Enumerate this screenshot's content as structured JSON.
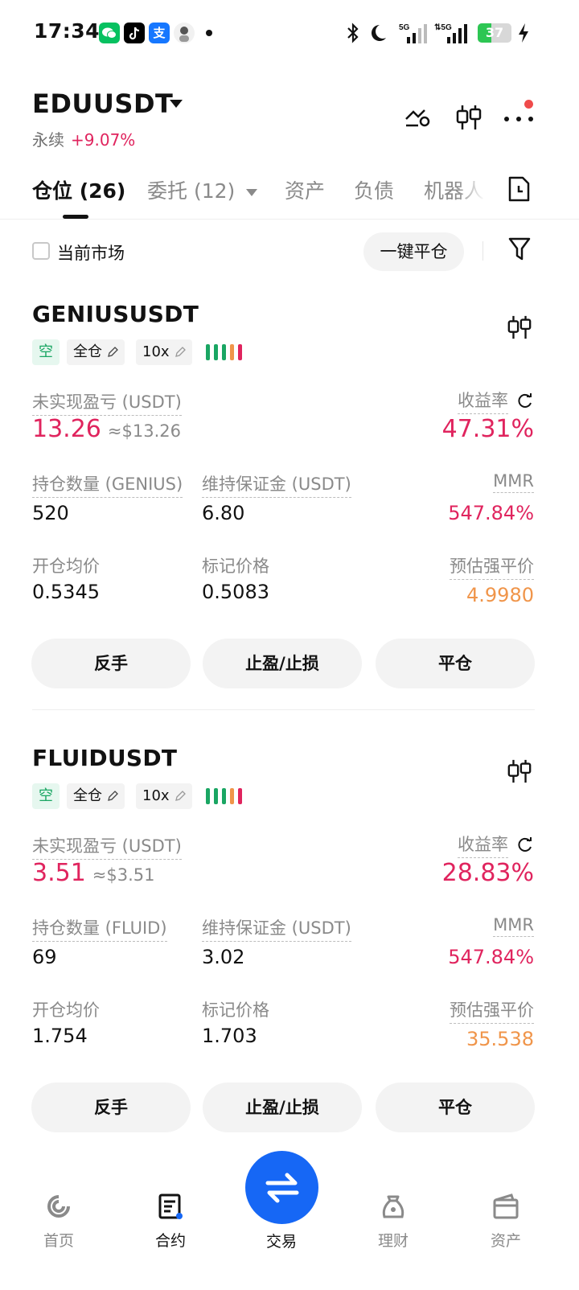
{
  "status_bar": {
    "time": "17:34",
    "battery": "37",
    "network_1": "5G",
    "network_2": "5G",
    "app_icons": [
      "wechat-icon",
      "tiktok-icon",
      "alipay-icon",
      "avatar-icon"
    ]
  },
  "header": {
    "symbol": "EDUUSDT",
    "contract_type": "永续",
    "change": "+9.07%"
  },
  "tabs": [
    {
      "label": "仓位 (26)",
      "active": true
    },
    {
      "label": "委托 (12)",
      "active": false
    },
    {
      "label": "资产",
      "active": false
    },
    {
      "label": "负债",
      "active": false
    },
    {
      "label": "机器人",
      "active": false
    }
  ],
  "filter": {
    "current_market_label": "当前市场",
    "close_all_label": "一键平仓"
  },
  "positions": [
    {
      "pair": "GENIUSUSDT",
      "side": "空",
      "margin_mode": "全仓",
      "leverage": "10x",
      "unrealized_pnl_label": "未实现盈亏 (USDT)",
      "unrealized_pnl": "13.26",
      "unrealized_pnl_usd": "≈$13.26",
      "roe_label": "收益率",
      "roe": "47.31%",
      "size_label": "持仓数量 (GENIUS)",
      "size": "520",
      "maint_margin_label": "维持保证金 (USDT)",
      "maint_margin": "6.80",
      "mmr_label": "MMR",
      "mmr": "547.84%",
      "entry_price_label": "开仓均价",
      "entry_price": "0.5345",
      "mark_price_label": "标记价格",
      "mark_price": "0.5083",
      "liq_price_label": "预估强平价",
      "liq_price": "4.9980",
      "buttons": {
        "reverse": "反手",
        "tpsl": "止盈/止损",
        "close": "平仓"
      }
    },
    {
      "pair": "FLUIDUSDT",
      "side": "空",
      "margin_mode": "全仓",
      "leverage": "10x",
      "unrealized_pnl_label": "未实现盈亏 (USDT)",
      "unrealized_pnl": "3.51",
      "unrealized_pnl_usd": "≈$3.51",
      "roe_label": "收益率",
      "roe": "28.83%",
      "size_label": "持仓数量 (FLUID)",
      "size": "69",
      "maint_margin_label": "维持保证金 (USDT)",
      "maint_margin": "3.02",
      "mmr_label": "MMR",
      "mmr": "547.84%",
      "entry_price_label": "开仓均价",
      "entry_price": "1.754",
      "mark_price_label": "标记价格",
      "mark_price": "1.703",
      "liq_price_label": "预估强平价",
      "liq_price": "35.538",
      "buttons": {
        "reverse": "反手",
        "tpsl": "止盈/止损",
        "close": "平仓"
      }
    }
  ],
  "bottom_nav": [
    {
      "label": "首页",
      "icon": "home-icon",
      "active": false
    },
    {
      "label": "合约",
      "icon": "futures-icon",
      "active": true
    },
    {
      "label": "交易",
      "icon": "swap-icon",
      "active": false
    },
    {
      "label": "理财",
      "icon": "earn-icon",
      "active": false
    },
    {
      "label": "资产",
      "icon": "wallet-icon",
      "active": false
    }
  ],
  "colors": {
    "red": "#e0245e",
    "green": "#1aa663",
    "orange": "#f0954a",
    "blue": "#1667f5"
  }
}
